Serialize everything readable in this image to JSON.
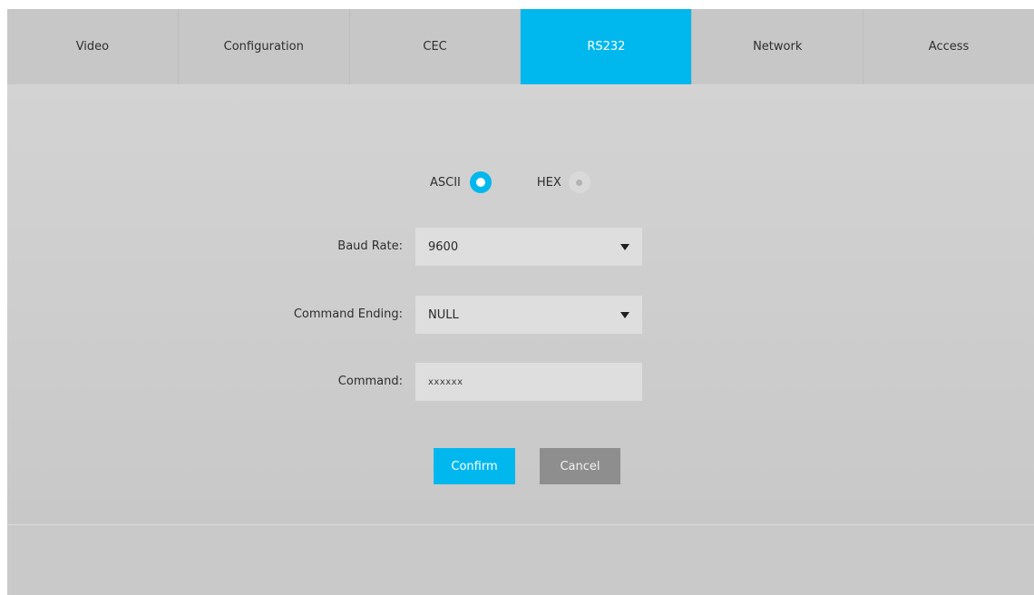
{
  "tabs": [
    {
      "label": "Video",
      "active": false
    },
    {
      "label": "Configuration",
      "active": false
    },
    {
      "label": "CEC",
      "active": false
    },
    {
      "label": "RS232",
      "active": true
    },
    {
      "label": "Network",
      "active": false
    },
    {
      "label": "Access",
      "active": false
    }
  ],
  "mode": {
    "ascii_label": "ASCII",
    "hex_label": "HEX",
    "selected": "ASCII"
  },
  "form": {
    "baud_rate": {
      "label": "Baud Rate:",
      "value": "9600"
    },
    "command_ending": {
      "label": "Command Ending:",
      "value": "NULL"
    },
    "command": {
      "label": "Command:",
      "value": "xxxxxx"
    }
  },
  "buttons": {
    "confirm_label": "Confirm",
    "cancel_label": "Cancel"
  },
  "colors": {
    "accent": "#00b8ee",
    "background": "#c9c9c9",
    "field": "#dedede",
    "cancel": "#8e8e8e"
  }
}
